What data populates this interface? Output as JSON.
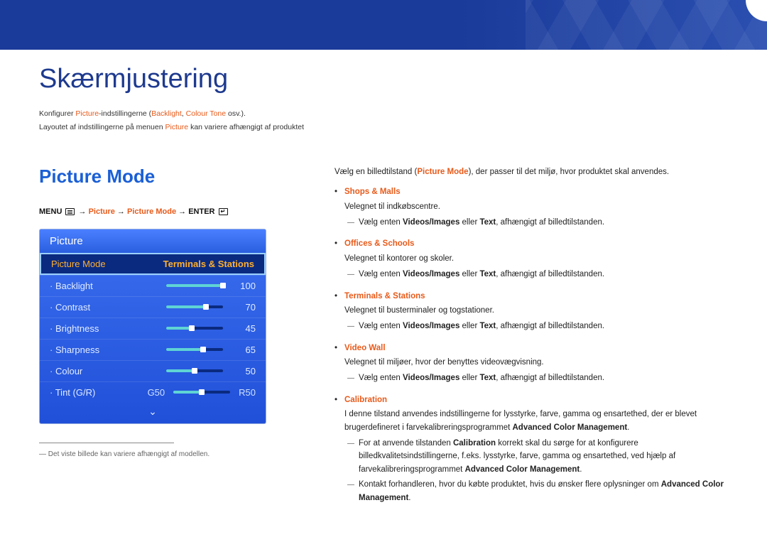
{
  "header": {
    "title": "Skærmjustering"
  },
  "intro": {
    "line1_a": "Konfigurer ",
    "line1_b": "Picture",
    "line1_c": "-indstillingerne (",
    "line1_d": "Backlight",
    "line1_e": ", ",
    "line1_f": "Colour Tone",
    "line1_g": " osv.).",
    "line2_a": "Layoutet af indstillingerne på menuen ",
    "line2_b": "Picture",
    "line2_c": " kan variere afhængigt af produktet"
  },
  "left": {
    "heading": "Picture Mode",
    "bc_menu": "MENU",
    "bc_arrow1": " → ",
    "bc_pic": "Picture",
    "bc_arrow2": " → ",
    "bc_pm": "Picture Mode",
    "bc_arrow3": " → ",
    "bc_enter": "ENTER",
    "osd_title": "Picture",
    "selected_label": "Picture Mode",
    "selected_value": "Terminals & Stations",
    "rows": [
      {
        "name": "Backlight",
        "value": "100",
        "pct": 100
      },
      {
        "name": "Contrast",
        "value": "70",
        "pct": 70
      },
      {
        "name": "Brightness",
        "value": "45",
        "pct": 45
      },
      {
        "name": "Sharpness",
        "value": "65",
        "pct": 65
      },
      {
        "name": "Colour",
        "value": "50",
        "pct": 50
      }
    ],
    "tint_name": "Tint (G/R)",
    "tint_g": "G50",
    "tint_r": "R50",
    "more": "⌄",
    "footnote": "Det viste billede kan variere afhængigt af modellen."
  },
  "right": {
    "intro_a": "Vælg en billedtilstand (",
    "intro_b": "Picture Mode",
    "intro_c": "), der passer til det miljø, hvor produktet skal anvendes.",
    "modes": {
      "shops": {
        "name": "Shops & Malls",
        "desc": "Velegnet til indkøbscentre.",
        "sub_a": "Vælg enten ",
        "sub_b": "Videos/Images",
        "sub_c": " eller ",
        "sub_d": "Text",
        "sub_e": ", afhængigt af billedtilstanden."
      },
      "offices": {
        "name": "Offices & Schools",
        "desc": "Velegnet til kontorer og skoler.",
        "sub_a": "Vælg enten ",
        "sub_b": "Videos/Images",
        "sub_c": " eller ",
        "sub_d": "Text",
        "sub_e": ", afhængigt af billedtilstanden."
      },
      "terminals": {
        "name": "Terminals & Stations",
        "desc": "Velegnet til busterminaler og togstationer.",
        "sub_a": "Vælg enten ",
        "sub_b": "Videos/Images",
        "sub_c": " eller ",
        "sub_d": "Text",
        "sub_e": ", afhængigt af billedtilstanden."
      },
      "videowall": {
        "name": "Video Wall",
        "desc": "Velegnet til miljøer, hvor der benyttes videovægvisning.",
        "sub_a": "Vælg enten ",
        "sub_b": "Videos/Images",
        "sub_c": " eller ",
        "sub_d": "Text",
        "sub_e": ", afhængigt af billedtilstanden."
      },
      "calibration": {
        "name": "Calibration",
        "desc_a": "I denne tilstand anvendes indstillingerne for lysstyrke, farve, gamma og ensartethed, der er blevet brugerdefineret i farvekalibreringsprogrammet ",
        "desc_b": "Advanced Color Management",
        "desc_c": ".",
        "sub1_a": "For at anvende tilstanden ",
        "sub1_b": "Calibration",
        "sub1_c": " korrekt skal du sørge for at konfigurere billedkvalitetsindstillingerne, f.eks. lysstyrke, farve, gamma og ensartethed, ved hjælp af farvekalibreringsprogrammet ",
        "sub1_d": "Advanced Color Management",
        "sub1_e": ".",
        "sub2_a": "Kontakt forhandleren, hvor du købte produktet, hvis du ønsker flere oplysninger om ",
        "sub2_b": "Advanced Color Management",
        "sub2_c": "."
      }
    }
  }
}
